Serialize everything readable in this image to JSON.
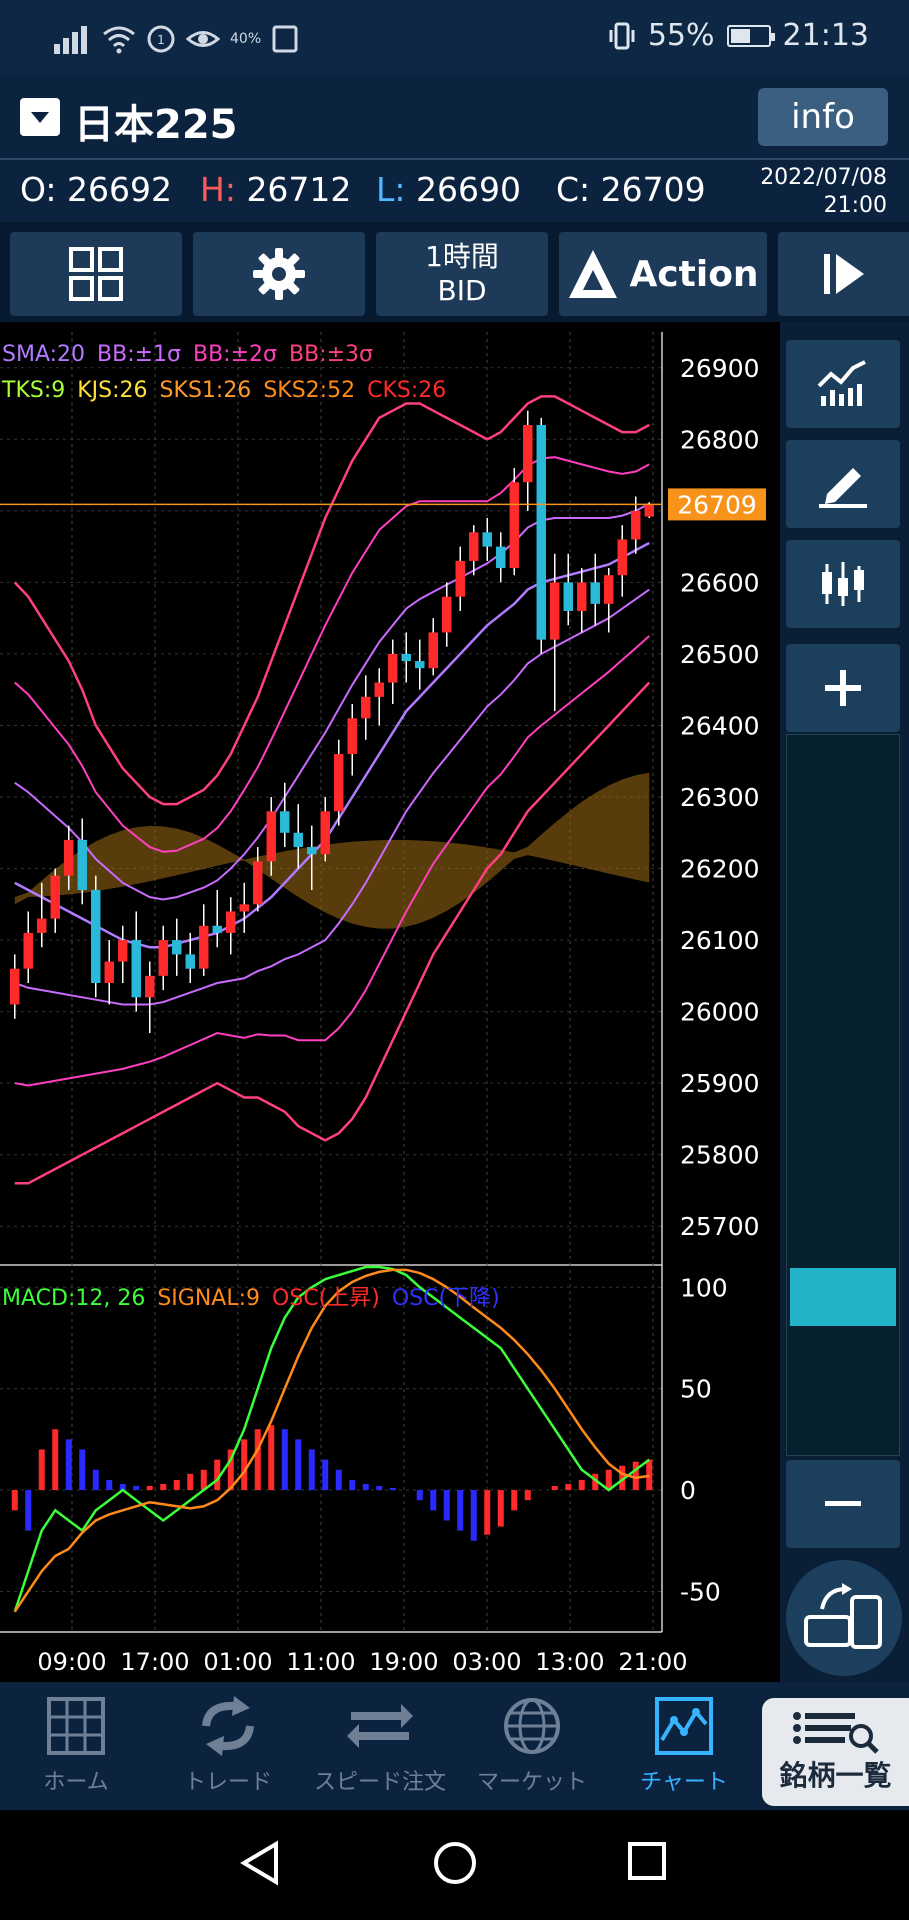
{
  "status_bar": {
    "battery_text": "55%",
    "battery_level": 0.55,
    "time": "21:13",
    "data_saver_text": "40%"
  },
  "header": {
    "symbol": "日本225",
    "info_label": "info",
    "ohlc": {
      "o_key": "O:",
      "o_val": "26692",
      "h_key": "H:",
      "h_val": "26712",
      "l_key": "L:",
      "l_val": "26690",
      "c_key": "C:",
      "c_val": "26709"
    },
    "date": "2022/07/08",
    "time": "21:00",
    "colors": {
      "h": "#ff5a5a",
      "l": "#4fb8ff"
    }
  },
  "toolbar": {
    "timeframe_line1": "1時間",
    "timeframe_line2": "BID",
    "action_label": "Action",
    "icons": [
      "grid-icon",
      "gear-icon",
      "action-logo-icon",
      "play-step-icon"
    ]
  },
  "price_legend": {
    "row1": [
      {
        "text": "SMA:20",
        "color": "#b07bff"
      },
      {
        "text": "BB:±1σ",
        "color": "#c96bff"
      },
      {
        "text": "BB:±2σ",
        "color": "#ff3fbf"
      },
      {
        "text": "BB:±3σ",
        "color": "#ff3f7f"
      }
    ],
    "row2": [
      {
        "text": "TKS:9",
        "color": "#a8ff3a"
      },
      {
        "text": "KJS:26",
        "color": "#ffe13a"
      },
      {
        "text": "SKS1:26",
        "color": "#ff9a2a"
      },
      {
        "text": "SKS2:52",
        "color": "#ff8a1a"
      },
      {
        "text": "CKS:26",
        "color": "#ff2a2a"
      }
    ]
  },
  "macd_legend": [
    {
      "text": "MACD:12, 26",
      "color": "#3aff3a"
    },
    {
      "text": "SIGNAL:9",
      "color": "#ff8a1a"
    },
    {
      "text": "OSC(上昇)",
      "color": "#ff2a2a"
    },
    {
      "text": "OSC(下降)",
      "color": "#3030ff"
    }
  ],
  "chart_data": {
    "type": "line",
    "price_axis": {
      "ticks": [
        "26900",
        "26800",
        "26700",
        "26600",
        "26500",
        "26400",
        "26300",
        "26200",
        "26100",
        "26000",
        "25900",
        "25800",
        "25700"
      ],
      "range": [
        25650,
        26950
      ]
    },
    "current_price": "26709",
    "macd_axis": {
      "ticks": [
        "100",
        "50",
        "0",
        "-50"
      ],
      "range": [
        -70,
        110
      ]
    },
    "time_ticks": [
      "09:00",
      "17:00",
      "01:00",
      "11:00",
      "19:00",
      "03:00",
      "13:00",
      "21:00"
    ],
    "candles": [
      [
        26010,
        26080,
        25990,
        26060
      ],
      [
        26060,
        26140,
        26040,
        26110
      ],
      [
        26110,
        26180,
        26090,
        26130
      ],
      [
        26130,
        26200,
        26110,
        26190
      ],
      [
        26190,
        26260,
        26170,
        26240
      ],
      [
        26240,
        26270,
        26150,
        26170
      ],
      [
        26170,
        26190,
        26020,
        26040
      ],
      [
        26040,
        26100,
        26010,
        26070
      ],
      [
        26070,
        26120,
        26040,
        26100
      ],
      [
        26100,
        26140,
        26000,
        26020
      ],
      [
        26020,
        26070,
        25970,
        26050
      ],
      [
        26050,
        26120,
        26030,
        26100
      ],
      [
        26100,
        26130,
        26050,
        26080
      ],
      [
        26080,
        26110,
        26040,
        26060
      ],
      [
        26060,
        26150,
        26050,
        26120
      ],
      [
        26120,
        26170,
        26090,
        26110
      ],
      [
        26110,
        26160,
        26080,
        26140
      ],
      [
        26140,
        26180,
        26110,
        26150
      ],
      [
        26150,
        26230,
        26140,
        26210
      ],
      [
        26210,
        26300,
        26190,
        26280
      ],
      [
        26280,
        26320,
        26230,
        26250
      ],
      [
        26250,
        26290,
        26200,
        26230
      ],
      [
        26230,
        26260,
        26170,
        26220
      ],
      [
        26220,
        26300,
        26210,
        26280
      ],
      [
        26280,
        26380,
        26260,
        26360
      ],
      [
        26360,
        26430,
        26330,
        26410
      ],
      [
        26410,
        26470,
        26380,
        26440
      ],
      [
        26440,
        26480,
        26400,
        26460
      ],
      [
        26460,
        26520,
        26430,
        26500
      ],
      [
        26500,
        26530,
        26460,
        26490
      ],
      [
        26490,
        26520,
        26450,
        26480
      ],
      [
        26480,
        26550,
        26470,
        26530
      ],
      [
        26530,
        26600,
        26510,
        26580
      ],
      [
        26580,
        26650,
        26560,
        26630
      ],
      [
        26630,
        26680,
        26610,
        26670
      ],
      [
        26670,
        26690,
        26630,
        26650
      ],
      [
        26650,
        26670,
        26600,
        26620
      ],
      [
        26620,
        26760,
        26610,
        26740
      ],
      [
        26740,
        26840,
        26700,
        26820
      ],
      [
        26820,
        26830,
        26500,
        26520
      ],
      [
        26520,
        26640,
        26420,
        26600
      ],
      [
        26600,
        26640,
        26540,
        26560
      ],
      [
        26560,
        26620,
        26530,
        26600
      ],
      [
        26600,
        26640,
        26540,
        26570
      ],
      [
        26570,
        26620,
        26530,
        26610
      ],
      [
        26610,
        26680,
        26580,
        26660
      ],
      [
        26660,
        26720,
        26640,
        26700
      ],
      [
        26692,
        26712,
        26690,
        26709
      ]
    ],
    "series": [
      {
        "name": "SMA:20",
        "values": [
          26180,
          26170,
          26160,
          26150,
          26140,
          26130,
          26120,
          26110,
          26100,
          26095,
          26090,
          26090,
          26095,
          26100,
          26105,
          26110,
          26120,
          26130,
          26145,
          26160,
          26180,
          26200,
          26220,
          26240,
          26270,
          26300,
          26330,
          26360,
          26390,
          26420,
          26440,
          26460,
          26480,
          26500,
          26520,
          26540,
          26555,
          26570,
          26590,
          26600,
          26605,
          26610,
          26615,
          26620,
          26625,
          26635,
          26645,
          26655
        ]
      },
      {
        "name": "BB:+3σ",
        "values": [
          26600,
          26580,
          26550,
          26520,
          26490,
          26450,
          26400,
          26370,
          26340,
          26320,
          26300,
          26290,
          26290,
          26300,
          26310,
          26330,
          26360,
          26400,
          26440,
          26490,
          26540,
          26590,
          26640,
          26690,
          26730,
          26770,
          26800,
          26830,
          26840,
          26850,
          26850,
          26840,
          26830,
          26820,
          26810,
          26800,
          26810,
          26830,
          26850,
          26860,
          26860,
          26850,
          26840,
          26830,
          26820,
          26810,
          26810,
          26820
        ]
      },
      {
        "name": "BB:-3σ",
        "values": [
          25760,
          25760,
          25770,
          25780,
          25790,
          25800,
          25810,
          25820,
          25830,
          25840,
          25850,
          25860,
          25870,
          25880,
          25890,
          25900,
          25890,
          25880,
          25880,
          25870,
          25860,
          25840,
          25830,
          25820,
          25830,
          25850,
          25880,
          25920,
          25960,
          26000,
          26040,
          26080,
          26110,
          26140,
          26170,
          26200,
          26220,
          26250,
          26280,
          26300,
          26320,
          26340,
          26360,
          26380,
          26400,
          26420,
          26440,
          26460
        ]
      }
    ],
    "macd": {
      "macd": [
        -60,
        -40,
        -20,
        -10,
        -15,
        -20,
        -10,
        -5,
        0,
        -5,
        -10,
        -15,
        -10,
        -5,
        0,
        5,
        15,
        30,
        50,
        70,
        85,
        95,
        100,
        104,
        106,
        108,
        110,
        110,
        109,
        106,
        100,
        95,
        90,
        85,
        80,
        75,
        70,
        60,
        50,
        40,
        30,
        20,
        10,
        5,
        0,
        5,
        10,
        15
      ],
      "osc": [
        -10,
        -20,
        20,
        30,
        25,
        20,
        10,
        5,
        3,
        2,
        2,
        3,
        5,
        8,
        10,
        15,
        20,
        25,
        30,
        32,
        30,
        25,
        20,
        15,
        10,
        5,
        3,
        2,
        1,
        0,
        -5,
        -10,
        -15,
        -20,
        -25,
        -22,
        -18,
        -10,
        -5,
        0,
        2,
        3,
        5,
        8,
        10,
        12,
        14,
        15
      ]
    }
  },
  "sidebar": {
    "icons": [
      "indicator-chart-icon",
      "draw-pen-icon",
      "candlestick-icon",
      "zoom-in-icon",
      "zoom-out-icon",
      "rotate-device-icon"
    ],
    "zoom_level": 0.78
  },
  "tabbar": {
    "tabs": [
      {
        "label": "ホーム",
        "icon": "home-grid-icon"
      },
      {
        "label": "トレード",
        "icon": "trade-cycle-icon"
      },
      {
        "label": "スピード注文",
        "icon": "speed-order-icon"
      },
      {
        "label": "マーケット",
        "icon": "globe-icon"
      },
      {
        "label": "チャート",
        "icon": "chart-icon"
      }
    ],
    "active": "チャート",
    "meigara_label": "銘柄一覧"
  }
}
